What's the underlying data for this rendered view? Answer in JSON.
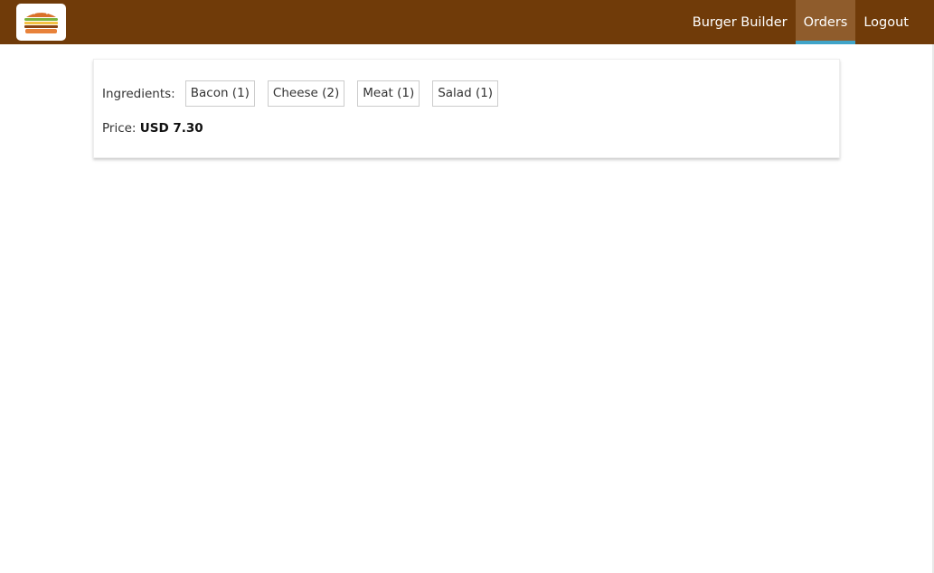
{
  "header": {
    "nav": [
      {
        "label": "Burger Builder",
        "active": false
      },
      {
        "label": "Orders",
        "active": true
      },
      {
        "label": "Logout",
        "active": false
      }
    ]
  },
  "order": {
    "ingredients_label": "Ingredients:",
    "ingredients": [
      {
        "label": "Bacon (1)"
      },
      {
        "label": "Cheese (2)"
      },
      {
        "label": "Meat (1)"
      },
      {
        "label": "Salad (1)"
      }
    ],
    "price_label": "Price:",
    "price_value": "USD 7.30"
  },
  "colors": {
    "toolbar": "#703b09",
    "active_nav": "#8f5c2c",
    "active_underline": "#40a4c8"
  },
  "icons": {
    "logo": "burger-logo-icon"
  }
}
